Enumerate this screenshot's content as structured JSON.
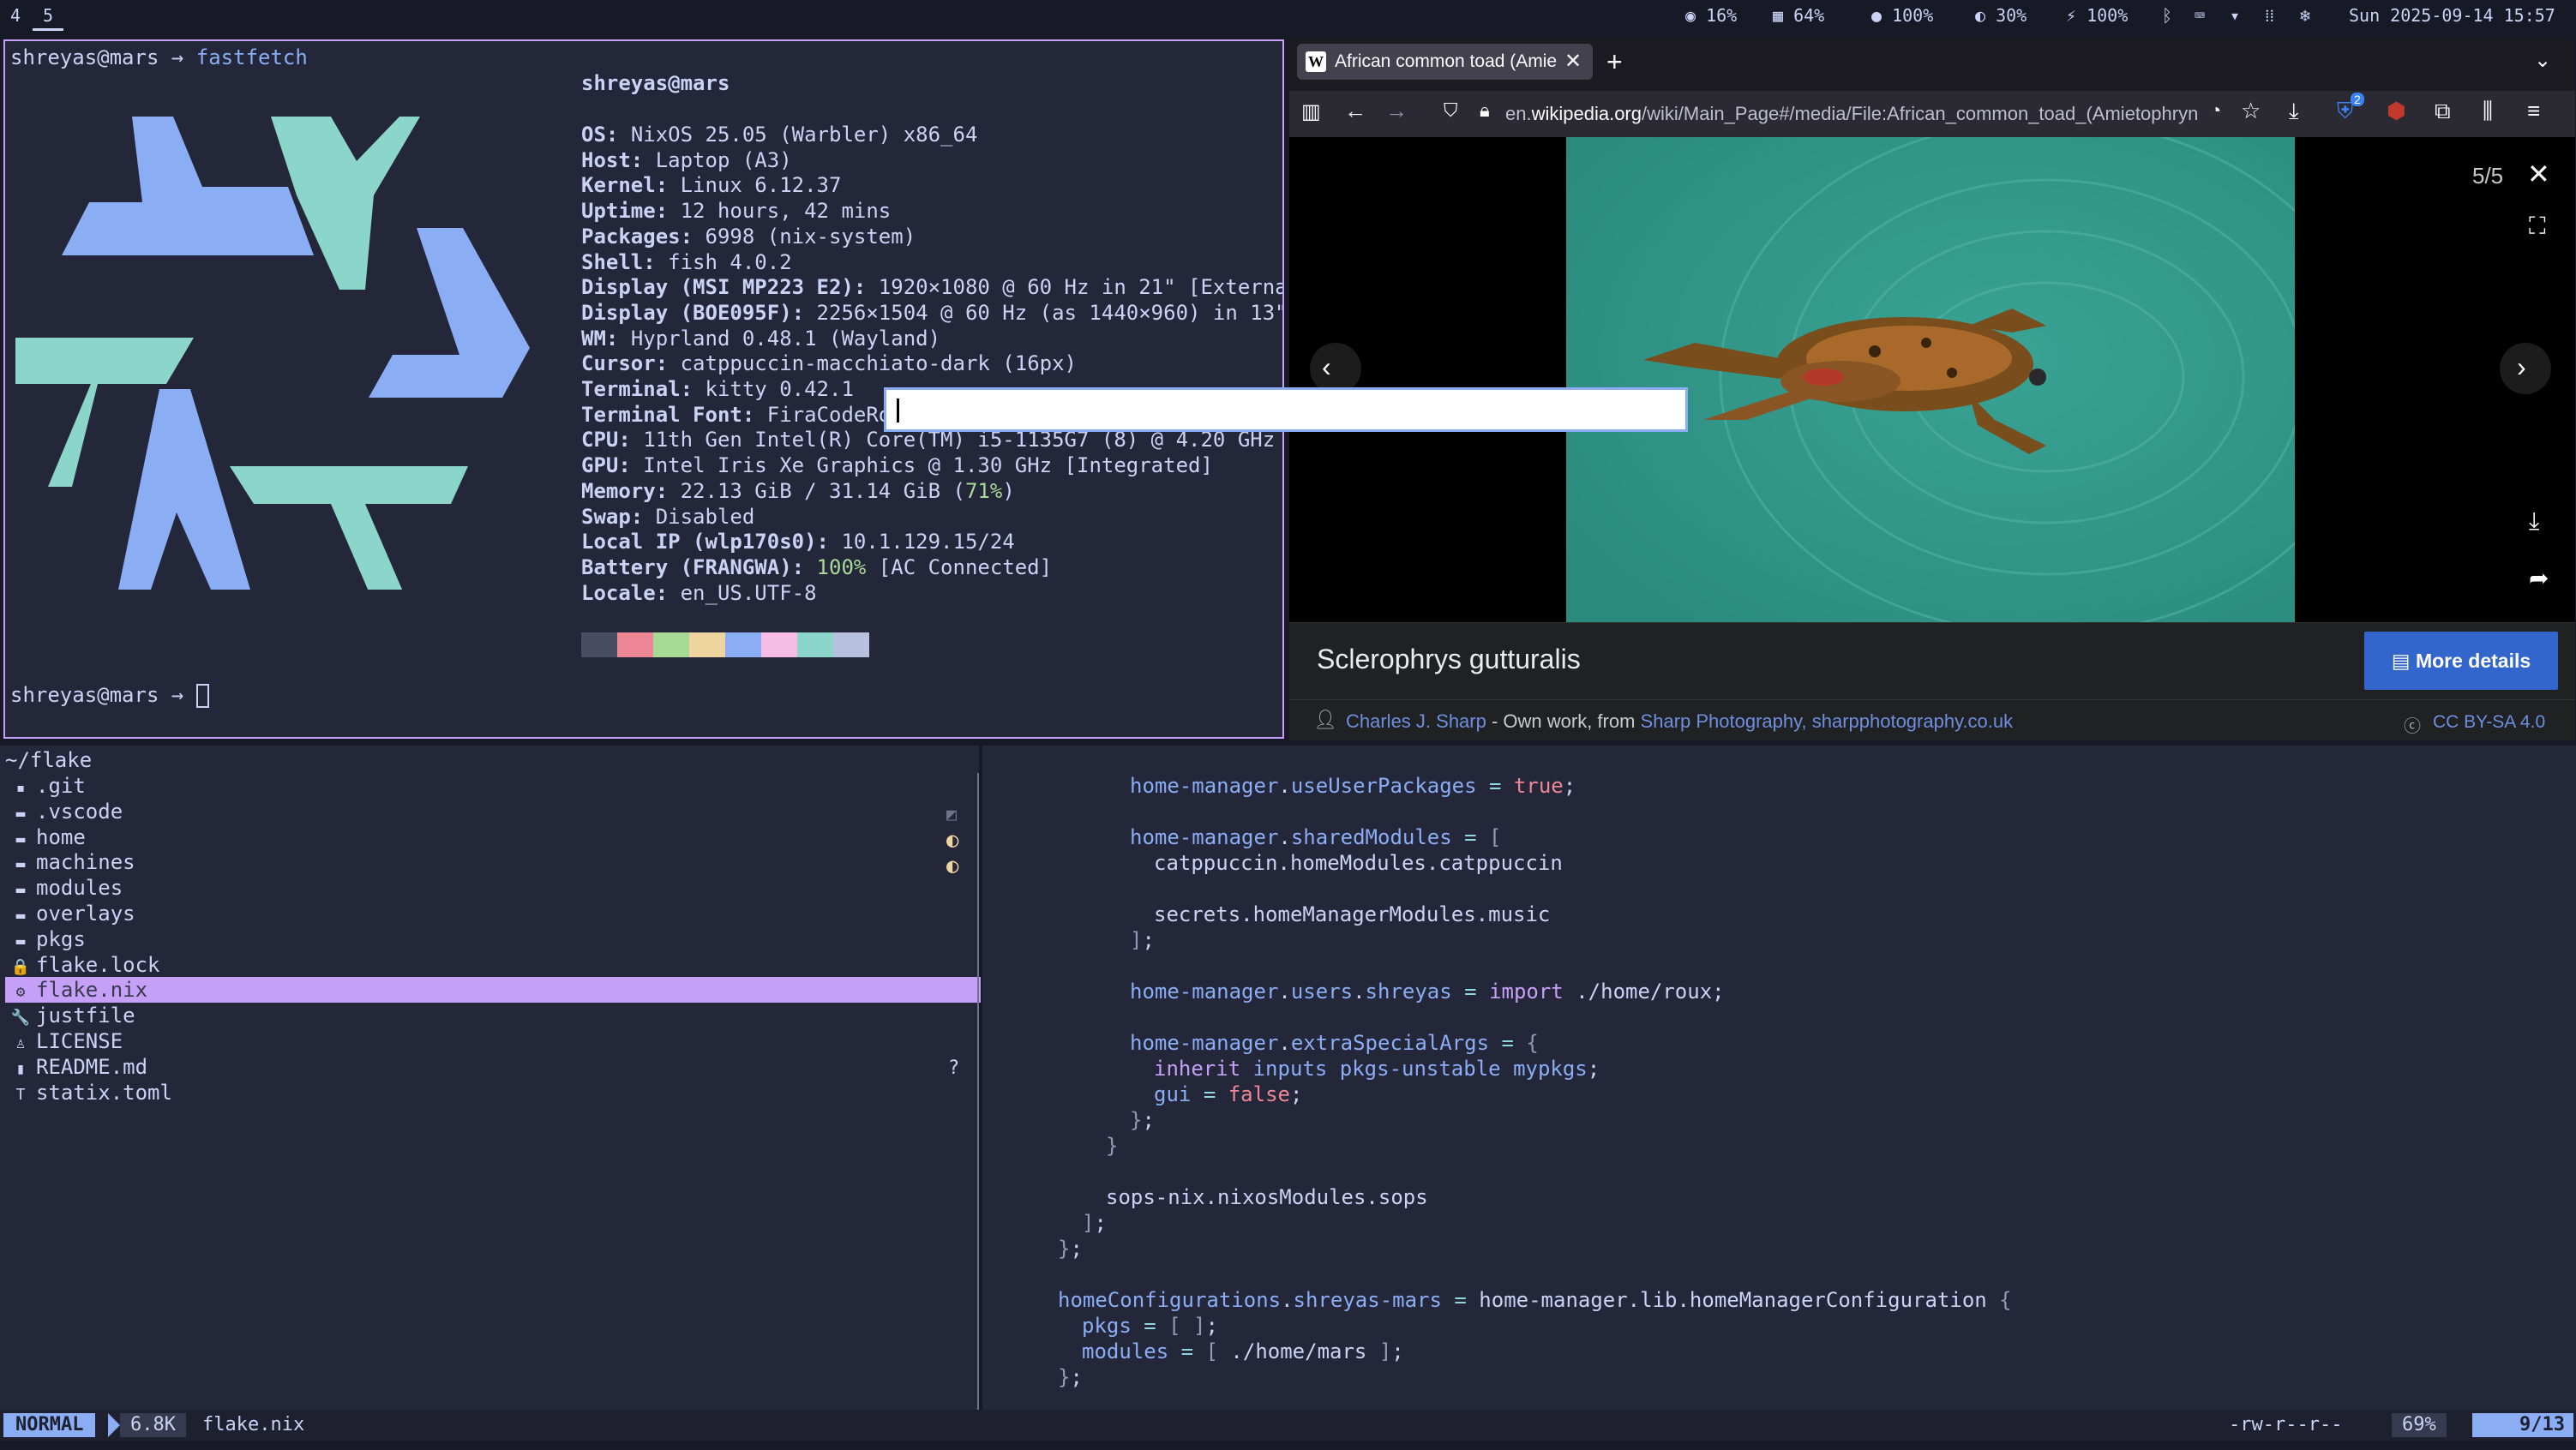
{
  "topbar": {
    "workspaces": [
      "4",
      "5"
    ],
    "active_workspace": "5",
    "cpu": "16%",
    "memory": "64%",
    "volume": "100%",
    "brightness": "30%",
    "battery": "100%",
    "datetime": "Sun 2025-09-14 15:57"
  },
  "terminal": {
    "prompt_user": "shreyas",
    "prompt_host": "mars",
    "prompt_arrow": "→",
    "command": "fastfetch",
    "header": "shreyas@mars",
    "info": [
      {
        "key": "OS",
        "value": "NixOS 25.05 (Warbler) x86_64"
      },
      {
        "key": "Host",
        "value": "Laptop (A3)"
      },
      {
        "key": "Kernel",
        "value": "Linux 6.12.37"
      },
      {
        "key": "Uptime",
        "value": "12 hours, 42 mins"
      },
      {
        "key": "Packages",
        "value": "6998 (nix-system)"
      },
      {
        "key": "Shell",
        "value": "fish 4.0.2"
      },
      {
        "key": "Display (MSI MP223 E2)",
        "value": "1920×1080 @ 60 Hz in 21\" [Externa]"
      },
      {
        "key": "Display (BOE095F)",
        "value": "2256×1504 @ 60 Hz (as 1440×960) in 13\"]"
      },
      {
        "key": "WM",
        "value": "Hyprland 0.48.1 (Wayland)"
      },
      {
        "key": "Cursor",
        "value": "catppuccin-macchiato-dark (16px)"
      },
      {
        "key": "Terminal",
        "value": "kitty 0.42.1"
      },
      {
        "key": "Terminal Font",
        "value": "FiraCodeRo"
      },
      {
        "key": "CPU",
        "value": "11th Gen Intel(R) Core(TM) i5-1135G7 (8) @ 4.20 GHz"
      },
      {
        "key": "GPU",
        "value": "Intel Iris Xe Graphics @ 1.30 GHz [Integrated]"
      },
      {
        "key": "Memory",
        "value": "22.13 GiB / 31.14 GiB (",
        "highlight": "71%",
        "suffix": ")"
      },
      {
        "key": "Swap",
        "value": "Disabled"
      },
      {
        "key": "Local IP (wlp170s0)",
        "value": "10.1.129.15/24"
      },
      {
        "key": "Battery (FRANGWA)",
        "value": "",
        "highlight": "100%",
        "suffix": " [AC Connected]"
      },
      {
        "key": "Locale",
        "value": "en_US.UTF-8"
      }
    ],
    "palette": [
      "#494d64",
      "#ed8796",
      "#a6da95",
      "#eed49f",
      "#8aadf4",
      "#f5bde6",
      "#8bd5ca",
      "#b8c0e0"
    ]
  },
  "browser": {
    "tab_title": "African common toad (Amie",
    "url_prefix": "en.",
    "url_domain": "wikipedia.org",
    "url_path": "/wiki/Main_Page#/media/File:African_common_toad_(Amietophryn",
    "ublock_count": "2",
    "counter": "5/5",
    "caption_title": "Sclerophrys gutturalis",
    "more_details": "More details",
    "author": "Charles J. Sharp",
    "attribution_mid": " - Own work, from ",
    "source_link": "Sharp Photography, sharpphotography.co.uk",
    "license": "CC BY-SA 4.0"
  },
  "tree": {
    "root": "~/flake",
    "items": [
      {
        "icon": "git-folder-icon",
        "glyph": "▪",
        "name": ".git"
      },
      {
        "icon": "folder-icon",
        "glyph": "▬",
        "name": ".vscode"
      },
      {
        "icon": "folder-icon",
        "glyph": "▬",
        "name": "home"
      },
      {
        "icon": "folder-icon",
        "glyph": "▬",
        "name": "machines"
      },
      {
        "icon": "folder-icon",
        "glyph": "▬",
        "name": "modules"
      },
      {
        "icon": "folder-icon",
        "glyph": "▬",
        "name": "overlays"
      },
      {
        "icon": "folder-icon",
        "glyph": "▬",
        "name": "pkgs"
      },
      {
        "icon": "lock-icon",
        "glyph": "🔒",
        "name": "flake.lock"
      },
      {
        "icon": "gear-icon",
        "glyph": "⚙",
        "name": "flake.nix"
      },
      {
        "icon": "wrench-icon",
        "glyph": "🔧",
        "name": "justfile"
      },
      {
        "icon": "license-icon",
        "glyph": "♙",
        "name": "LICENSE"
      },
      {
        "icon": "markdown-icon",
        "glyph": "▮",
        "name": "README.md"
      },
      {
        "icon": "toml-icon",
        "glyph": "T",
        "name": "statix.toml"
      }
    ],
    "readme_marker": "?"
  },
  "editor": {
    "mode": "NORMAL",
    "filesize": "6.8K",
    "filename": "flake.nix",
    "permissions": "-rw-r--r--",
    "percent": "69%",
    "position": "9/13"
  }
}
